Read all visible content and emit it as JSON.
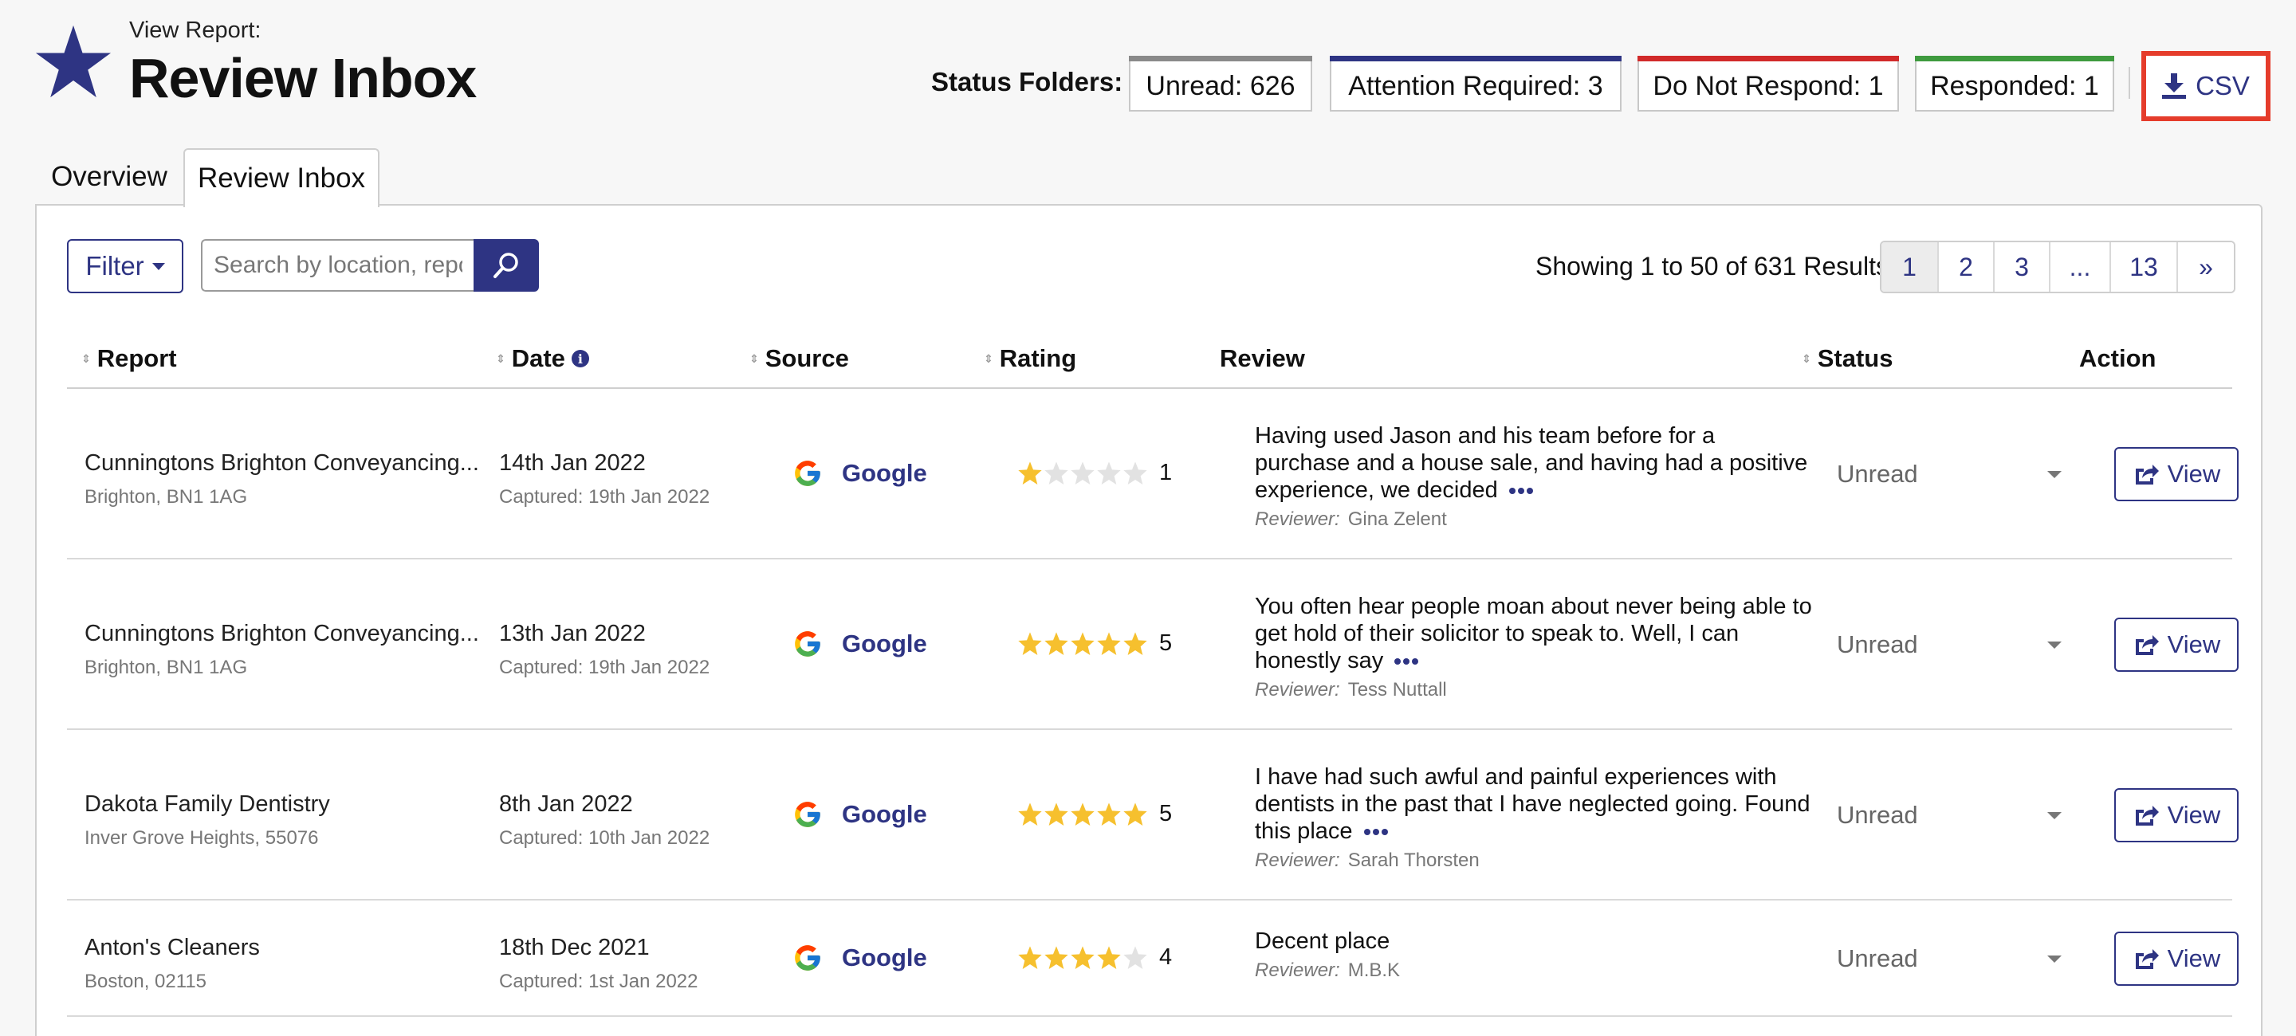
{
  "header": {
    "pre_title": "View Report:",
    "title": "Review Inbox",
    "status_label": "Status Folders:",
    "folders": [
      {
        "label": "Unread: 626",
        "color": "#8a8a8a"
      },
      {
        "label": "Attention Required: 3",
        "color": "#2e3483"
      },
      {
        "label": "Do Not Respond: 1",
        "color": "#d12a2a"
      },
      {
        "label": "Responded: 1",
        "color": "#3f9b3f"
      }
    ],
    "csv_label": "CSV"
  },
  "tabs": [
    {
      "label": "Overview",
      "active": false
    },
    {
      "label": "Review Inbox",
      "active": true
    }
  ],
  "toolbar": {
    "filter_label": "Filter",
    "search_placeholder": "Search by location, report",
    "showing": "Showing 1 to 50 of 631 Results",
    "pages": [
      "1",
      "2",
      "3",
      "...",
      "13",
      "»"
    ]
  },
  "table": {
    "columns": {
      "report": "Report",
      "date": "Date",
      "source": "Source",
      "rating": "Rating",
      "review": "Review",
      "status": "Status",
      "action": "Action"
    },
    "rows": [
      {
        "report": "Cunningtons Brighton Conveyancing...",
        "location": "Brighton, BN1 1AG",
        "date": "14th Jan 2022",
        "captured": "Captured: 19th Jan 2022",
        "source": "Google",
        "rating": 1,
        "rating_text": "1",
        "review": "Having used Jason and his team before for a purchase and a house sale, and having had a positive experience, we decided",
        "reviewer_label": "Reviewer:",
        "reviewer": "Gina Zelent",
        "status": "Unread",
        "action": "View"
      },
      {
        "report": "Cunningtons Brighton Conveyancing...",
        "location": "Brighton, BN1 1AG",
        "date": "13th Jan 2022",
        "captured": "Captured: 19th Jan 2022",
        "source": "Google",
        "rating": 5,
        "rating_text": "5",
        "review": "You often hear people moan about never being able to get hold of their solicitor to speak to. Well, I can honestly say",
        "reviewer_label": "Reviewer:",
        "reviewer": "Tess Nuttall",
        "status": "Unread",
        "action": "View"
      },
      {
        "report": "Dakota Family Dentistry",
        "location": "Inver Grove Heights, 55076",
        "date": "8th Jan 2022",
        "captured": "Captured: 10th Jan 2022",
        "source": "Google",
        "rating": 5,
        "rating_text": "5",
        "review": "I have had such awful and painful experiences with dentists in the past that I have neglected going. Found this place",
        "reviewer_label": "Reviewer:",
        "reviewer": "Sarah Thorsten",
        "status": "Unread",
        "action": "View"
      },
      {
        "report": "Anton's Cleaners",
        "location": "Boston, 02115",
        "date": "18th Dec 2021",
        "captured": "Captured: 1st Jan 2022",
        "source": "Google",
        "rating": 4,
        "rating_text": "4",
        "review": "Decent place",
        "reviewer_label": "Reviewer:",
        "reviewer": "M.B.K",
        "status": "Unread",
        "action": "View"
      }
    ]
  },
  "colors": {
    "brand": "#2e3483",
    "star": "#f6c02e",
    "star_empty": "#e2e2e2",
    "csv_highlight": "#e53c2b"
  }
}
